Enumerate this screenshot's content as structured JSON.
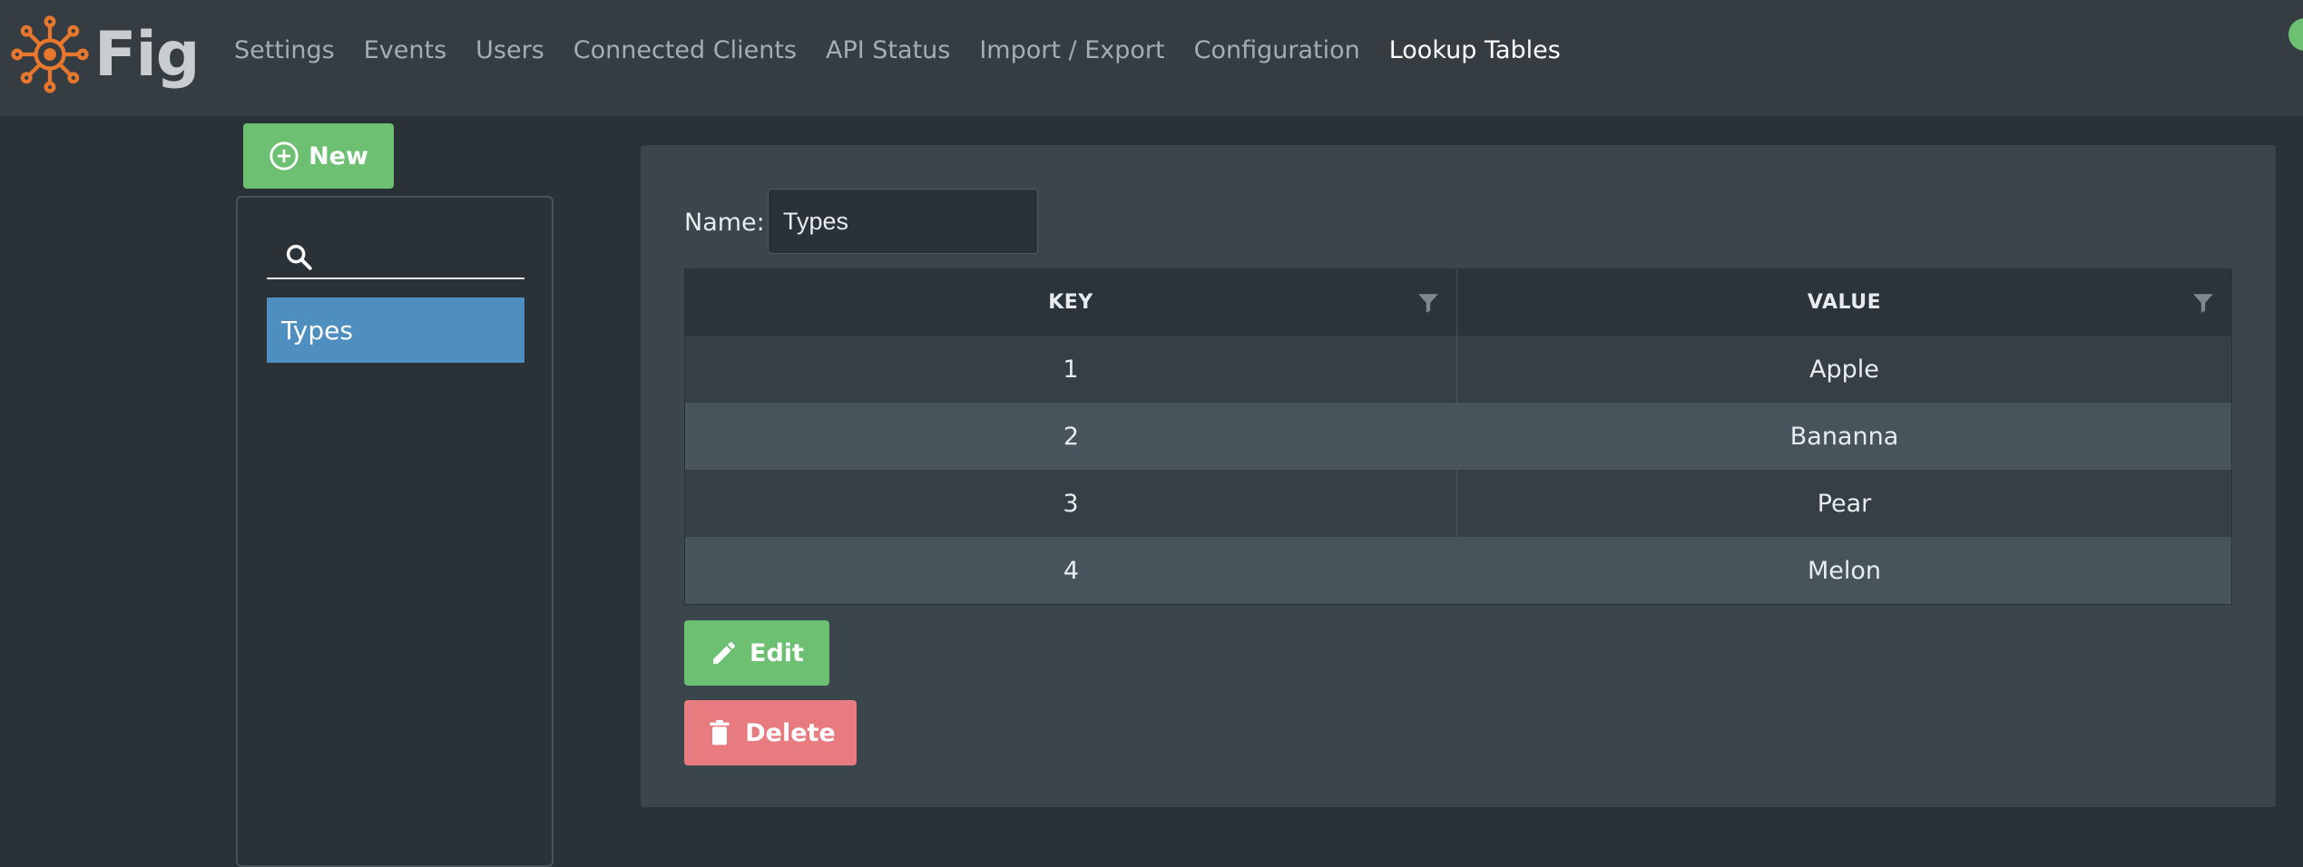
{
  "app": {
    "logo_text": "Fig"
  },
  "nav": {
    "items": [
      {
        "label": "Settings",
        "active": false
      },
      {
        "label": "Events",
        "active": false
      },
      {
        "label": "Users",
        "active": false
      },
      {
        "label": "Connected Clients",
        "active": false
      },
      {
        "label": "API Status",
        "active": false
      },
      {
        "label": "Import / Export",
        "active": false
      },
      {
        "label": "Configuration",
        "active": false
      },
      {
        "label": "Lookup Tables",
        "active": true
      }
    ]
  },
  "sidebar": {
    "new_button_label": "New",
    "search_placeholder": "",
    "items": [
      {
        "label": "Types",
        "selected": true
      }
    ]
  },
  "detail": {
    "name_label": "Name:",
    "name_value": "Types",
    "table": {
      "columns": [
        "KEY",
        "VALUE"
      ],
      "rows": [
        {
          "key": "1",
          "value": "Apple"
        },
        {
          "key": "2",
          "value": "Bananna"
        },
        {
          "key": "3",
          "value": "Pear"
        },
        {
          "key": "4",
          "value": "Melon"
        }
      ]
    },
    "edit_label": "Edit",
    "delete_label": "Delete"
  },
  "colors": {
    "accent_green": "#6dbf72",
    "accent_red": "#e87b80",
    "selected_blue": "#4f8fc0",
    "logo_orange": "#e8772e"
  },
  "icons": {
    "logo": "virus-gear-logo-icon",
    "new": "plus-circle-icon",
    "search": "search-icon",
    "filter": "filter-icon",
    "edit": "pencil-icon",
    "delete": "trash-icon"
  }
}
